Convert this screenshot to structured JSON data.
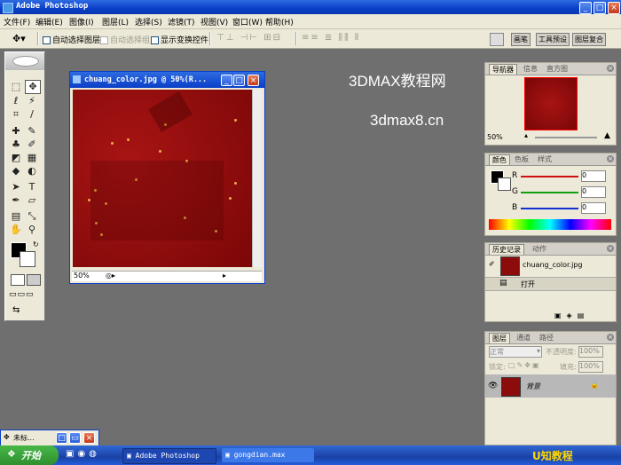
{
  "app": {
    "title": "Adobe Photoshop"
  },
  "menu": [
    "文件(F)",
    "编辑(E)",
    "图像(I)",
    "图层(L)",
    "选择(S)",
    "滤镜(T)",
    "视图(V)",
    "窗口(W)",
    "帮助(H)"
  ],
  "options": {
    "auto_select_layer": "自动选择图层",
    "auto_select_group": "自动选择组",
    "show_transform": "显示变换控件",
    "tabs": [
      "画笔",
      "工具预设",
      "图层复合"
    ]
  },
  "document": {
    "title": "chuang_color.jpg @ 50%(R...",
    "zoom": "50%",
    "canvas_color": "#8c0c0c"
  },
  "watermark": {
    "line1": "3DMAX教程网",
    "line2": "3dmax8.cn"
  },
  "navigator": {
    "tabs": [
      "导航器",
      "信息",
      "直方图"
    ],
    "zoom": "50%"
  },
  "color_panel": {
    "tabs": [
      "颜色",
      "色板",
      "样式"
    ],
    "channels": [
      {
        "label": "R",
        "value": "0",
        "color": "#d01010"
      },
      {
        "label": "G",
        "value": "0",
        "color": "#10a010"
      },
      {
        "label": "B",
        "value": "0",
        "color": "#1030d0"
      }
    ]
  },
  "history": {
    "tabs": [
      "历史记录",
      "动作"
    ],
    "snapshot": "chuang_color.jpg",
    "step": "打开"
  },
  "layers": {
    "tabs": [
      "图层",
      "通道",
      "路径"
    ],
    "blend_mode": "正常",
    "opacity_label": "不透明度:",
    "opacity": "100%",
    "lock_label": "锁定:",
    "fill_label": "填充:",
    "fill": "100%",
    "layer_name": "背景"
  },
  "taskbar": {
    "start": "开始",
    "minimized": "未标...",
    "tasks": [
      "Adobe Photoshop",
      "gongdian.max"
    ],
    "logo": "U知教程"
  }
}
